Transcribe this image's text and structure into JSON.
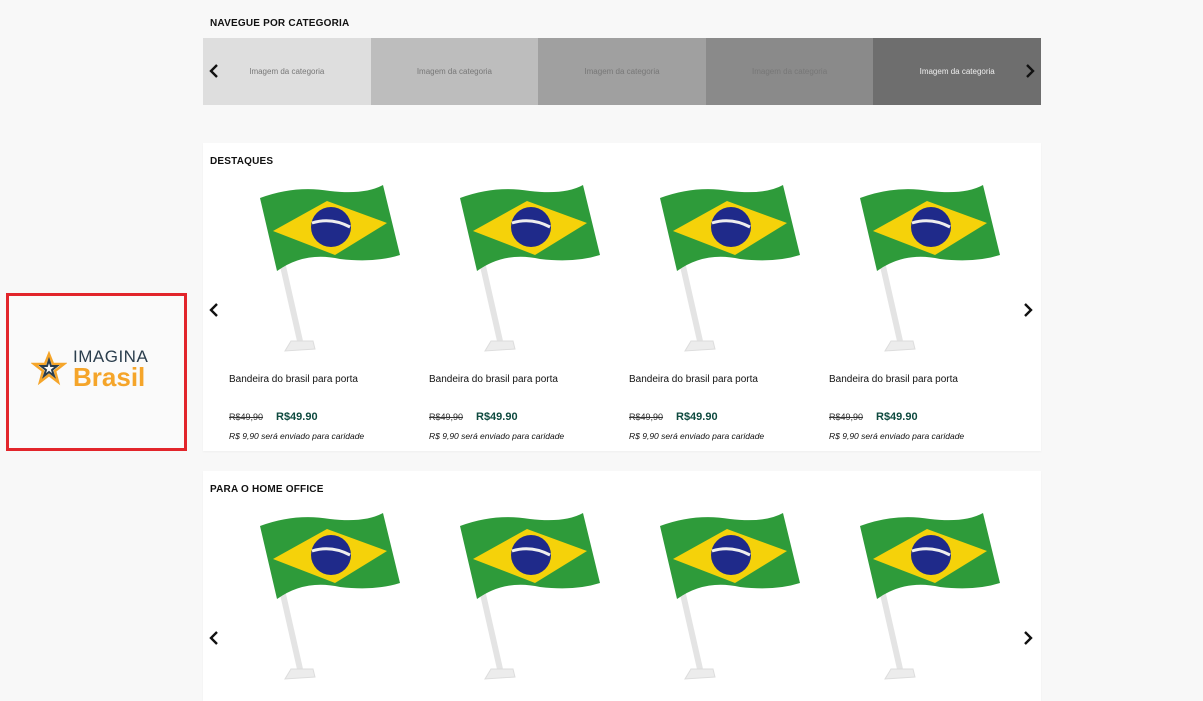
{
  "logo": {
    "line1": "IMAGINA",
    "line2": "Brasil"
  },
  "category_section": {
    "title": "NAVEGUE POR CATEGORIA",
    "tiles": [
      {
        "label": "Imagem da categoria",
        "color": "#dedede"
      },
      {
        "label": "Imagem da categoria",
        "color": "#bdbdbd"
      },
      {
        "label": "Imagem da categoria",
        "color": "#a0a0a0"
      },
      {
        "label": "Imagem da categoria",
        "color": "#8a8a8a"
      },
      {
        "label": "Imagem da categoria",
        "color": "#6e6e6e"
      }
    ]
  },
  "featured": {
    "title": "DESTAQUES",
    "products": [
      {
        "name": "Bandeira do brasil para porta",
        "old_price": "R$49,90",
        "price": "R$49.90",
        "charity": "R$ 9,90 será enviado para caridade"
      },
      {
        "name": "Bandeira do brasil para porta",
        "old_price": "R$49,90",
        "price": "R$49.90",
        "charity": "R$ 9,90 será enviado para caridade"
      },
      {
        "name": "Bandeira do brasil para porta",
        "old_price": "R$49,90",
        "price": "R$49.90",
        "charity": "R$ 9,90 será enviado para caridade"
      },
      {
        "name": "Bandeira do brasil para porta",
        "old_price": "R$49,90",
        "price": "R$49.90",
        "charity": "R$ 9,90 será enviado para caridade"
      }
    ]
  },
  "home_office": {
    "title": "PARA O HOME OFFICE"
  },
  "colors": {
    "logo_border": "#e2252b",
    "price": "#0e4a3f",
    "flag_green": "#2e9b3a",
    "flag_yellow": "#f5d20a",
    "flag_blue": "#1f2a8a"
  }
}
